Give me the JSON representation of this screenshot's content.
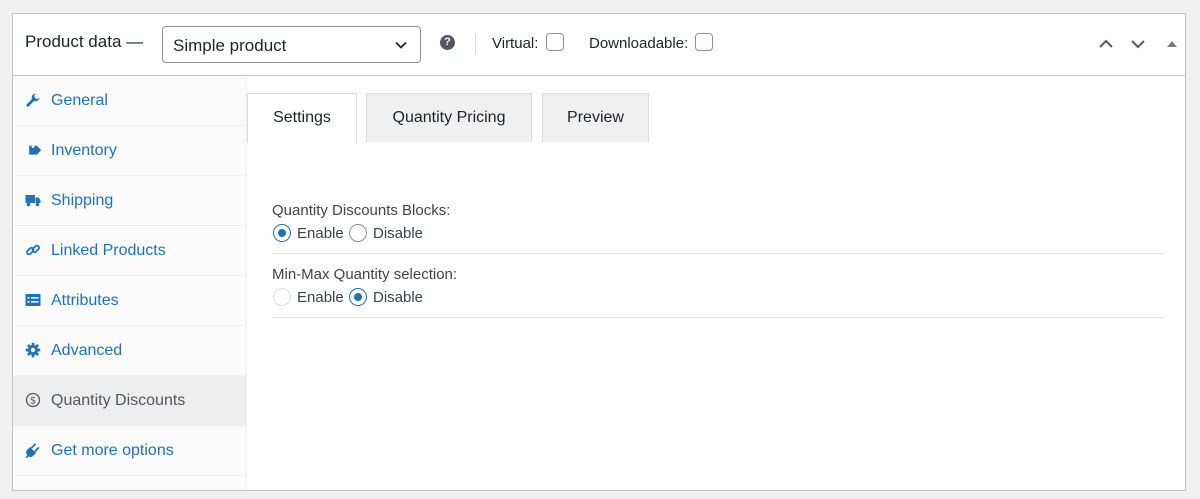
{
  "header": {
    "title": "Product data —",
    "product_type": "Simple product",
    "help_glyph": "?",
    "virtual_label": "Virtual:",
    "downloadable_label": "Downloadable:"
  },
  "sidebar": {
    "items": [
      {
        "label": "General",
        "icon": "wrench-icon"
      },
      {
        "label": "Inventory",
        "icon": "tag-icon"
      },
      {
        "label": "Shipping",
        "icon": "truck-icon"
      },
      {
        "label": "Linked Products",
        "icon": "link-icon"
      },
      {
        "label": "Attributes",
        "icon": "list-icon"
      },
      {
        "label": "Advanced",
        "icon": "gear-icon"
      },
      {
        "label": "Quantity Discounts",
        "icon": "dollar-icon",
        "active": true
      },
      {
        "label": "Get more options",
        "icon": "plugin-icon"
      }
    ]
  },
  "tabs": [
    {
      "label": "Settings",
      "active": true
    },
    {
      "label": "Quantity Pricing"
    },
    {
      "label": "Preview"
    }
  ],
  "settings": {
    "qd_blocks": {
      "label": "Quantity Discounts Blocks:",
      "enable": "Enable",
      "disable": "Disable",
      "selected": "Enable"
    },
    "minmax": {
      "label": "Min-Max Quantity selection:",
      "enable": "Enable",
      "disable": "Disable",
      "selected": "Disable"
    }
  },
  "colors": {
    "link": "#2271b1",
    "accent": "#2271b1"
  }
}
